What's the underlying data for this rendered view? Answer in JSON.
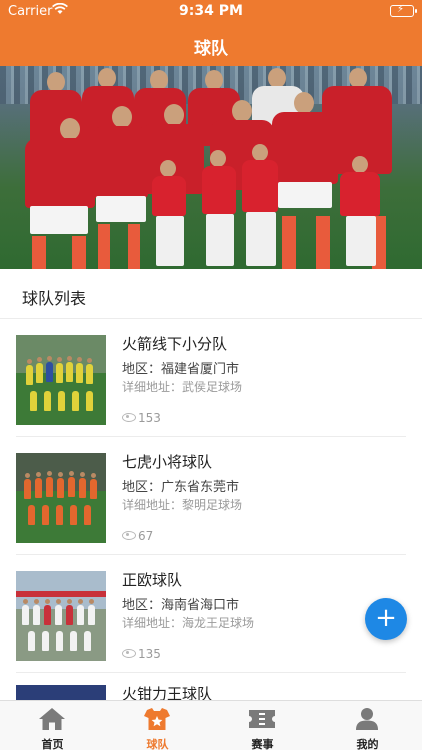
{
  "status_bar": {
    "carrier": "Carrier",
    "time": "9:34 PM"
  },
  "nav": {
    "title": "球队"
  },
  "colors": {
    "accent": "#ee7a2f",
    "fab": "#1e88e5",
    "inactive_tab": "#7a7a7a"
  },
  "section": {
    "title": "球队列表"
  },
  "teams": [
    {
      "name": "火箭线下小分队",
      "region": "地区：福建省厦门市",
      "address": "详细地址：武侯足球场",
      "views": "153"
    },
    {
      "name": "七虎小将球队",
      "region": "地区：广东省东莞市",
      "address": "详细地址：黎明足球场",
      "views": "67"
    },
    {
      "name": "正欧球队",
      "region": "地区：海南省海口市",
      "address": "详细地址：海龙王足球场",
      "views": "135"
    },
    {
      "name": "火钳力王球队",
      "region": "",
      "address": "",
      "views": ""
    }
  ],
  "fab": {
    "icon": "plus-icon",
    "glyph": "+"
  },
  "tabs": [
    {
      "label": "首页",
      "icon": "home-icon"
    },
    {
      "label": "球队",
      "icon": "team-icon",
      "active": true
    },
    {
      "label": "赛事",
      "icon": "ticket-icon"
    },
    {
      "label": "我的",
      "icon": "user-icon"
    }
  ]
}
